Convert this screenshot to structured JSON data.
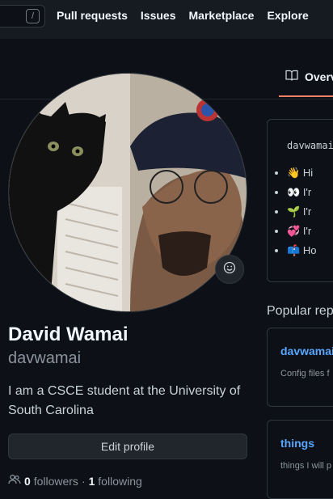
{
  "header": {
    "search_shortcut": "/",
    "nav": [
      "Pull requests",
      "Issues",
      "Marketplace",
      "Explore"
    ]
  },
  "tabs": {
    "overview": "Overv"
  },
  "profile": {
    "full_name": "David Wamai",
    "username": "davwamai",
    "bio": "I am a CSCE student at the University of South Carolina",
    "edit_button": "Edit profile",
    "followers_count": "0",
    "followers_label": "followers",
    "separator": "·",
    "following_count": "1",
    "following_label": "following"
  },
  "readme": {
    "title": "davwamai",
    "items": [
      {
        "emoji": "👋",
        "text": "Hi"
      },
      {
        "emoji": "👀",
        "text": "I'r"
      },
      {
        "emoji": "🌱",
        "text": "I'r"
      },
      {
        "emoji": "💞️",
        "text": "I'r"
      },
      {
        "emoji": "📫",
        "text": "Ho"
      }
    ]
  },
  "popular": {
    "heading": "Popular rep",
    "repos": [
      {
        "name": "davwamai",
        "description": "Config files f"
      },
      {
        "name": "things",
        "description": "things I will p"
      }
    ]
  },
  "colors": {
    "accent": "#f78166",
    "link": "#58a6ff",
    "bg": "#0d1117"
  },
  "icons": [
    "book-icon",
    "smiley-icon",
    "people-icon"
  ]
}
